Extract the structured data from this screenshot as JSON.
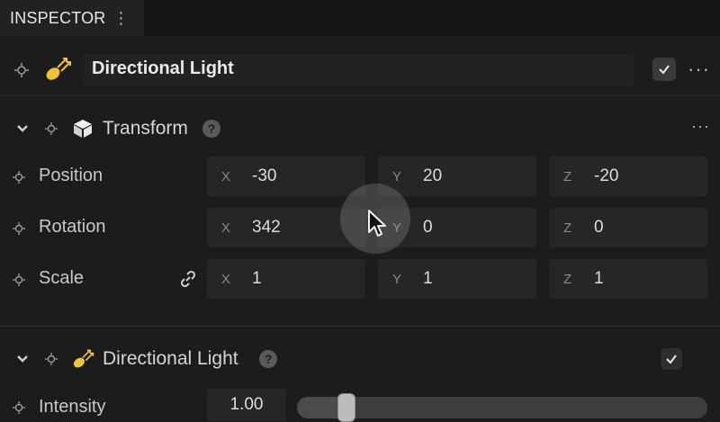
{
  "inspector": {
    "title": "INSPECTOR",
    "menu_glyph": "⋮"
  },
  "object": {
    "name": "Directional Light",
    "enabled": true,
    "more_glyph": "···"
  },
  "transform": {
    "title": "Transform",
    "help_glyph": "?",
    "more_glyph": "···",
    "rows": [
      {
        "label": "Position",
        "x": "-30",
        "y": "20",
        "z": "-20"
      },
      {
        "label": "Rotation",
        "x": "342",
        "y": "0",
        "z": "0"
      },
      {
        "label": "Scale",
        "x": "1",
        "y": "1",
        "z": "1"
      }
    ],
    "axis": {
      "x": "X",
      "y": "Y",
      "z": "Z"
    }
  },
  "light": {
    "title": "Directional Light",
    "help_glyph": "?",
    "enabled": true,
    "intensity": {
      "label": "Intensity",
      "value": "1.00",
      "slider_fraction": 0.12
    }
  },
  "colors": {
    "background": "#1c1c1c",
    "field": "#262626",
    "accent_icon": "#f0c23c"
  },
  "icons": [
    "target-icon",
    "light-icon",
    "cube-icon",
    "chevron-down-icon",
    "link-icon",
    "check-icon",
    "more-icon",
    "help-icon",
    "cursor-icon"
  ]
}
